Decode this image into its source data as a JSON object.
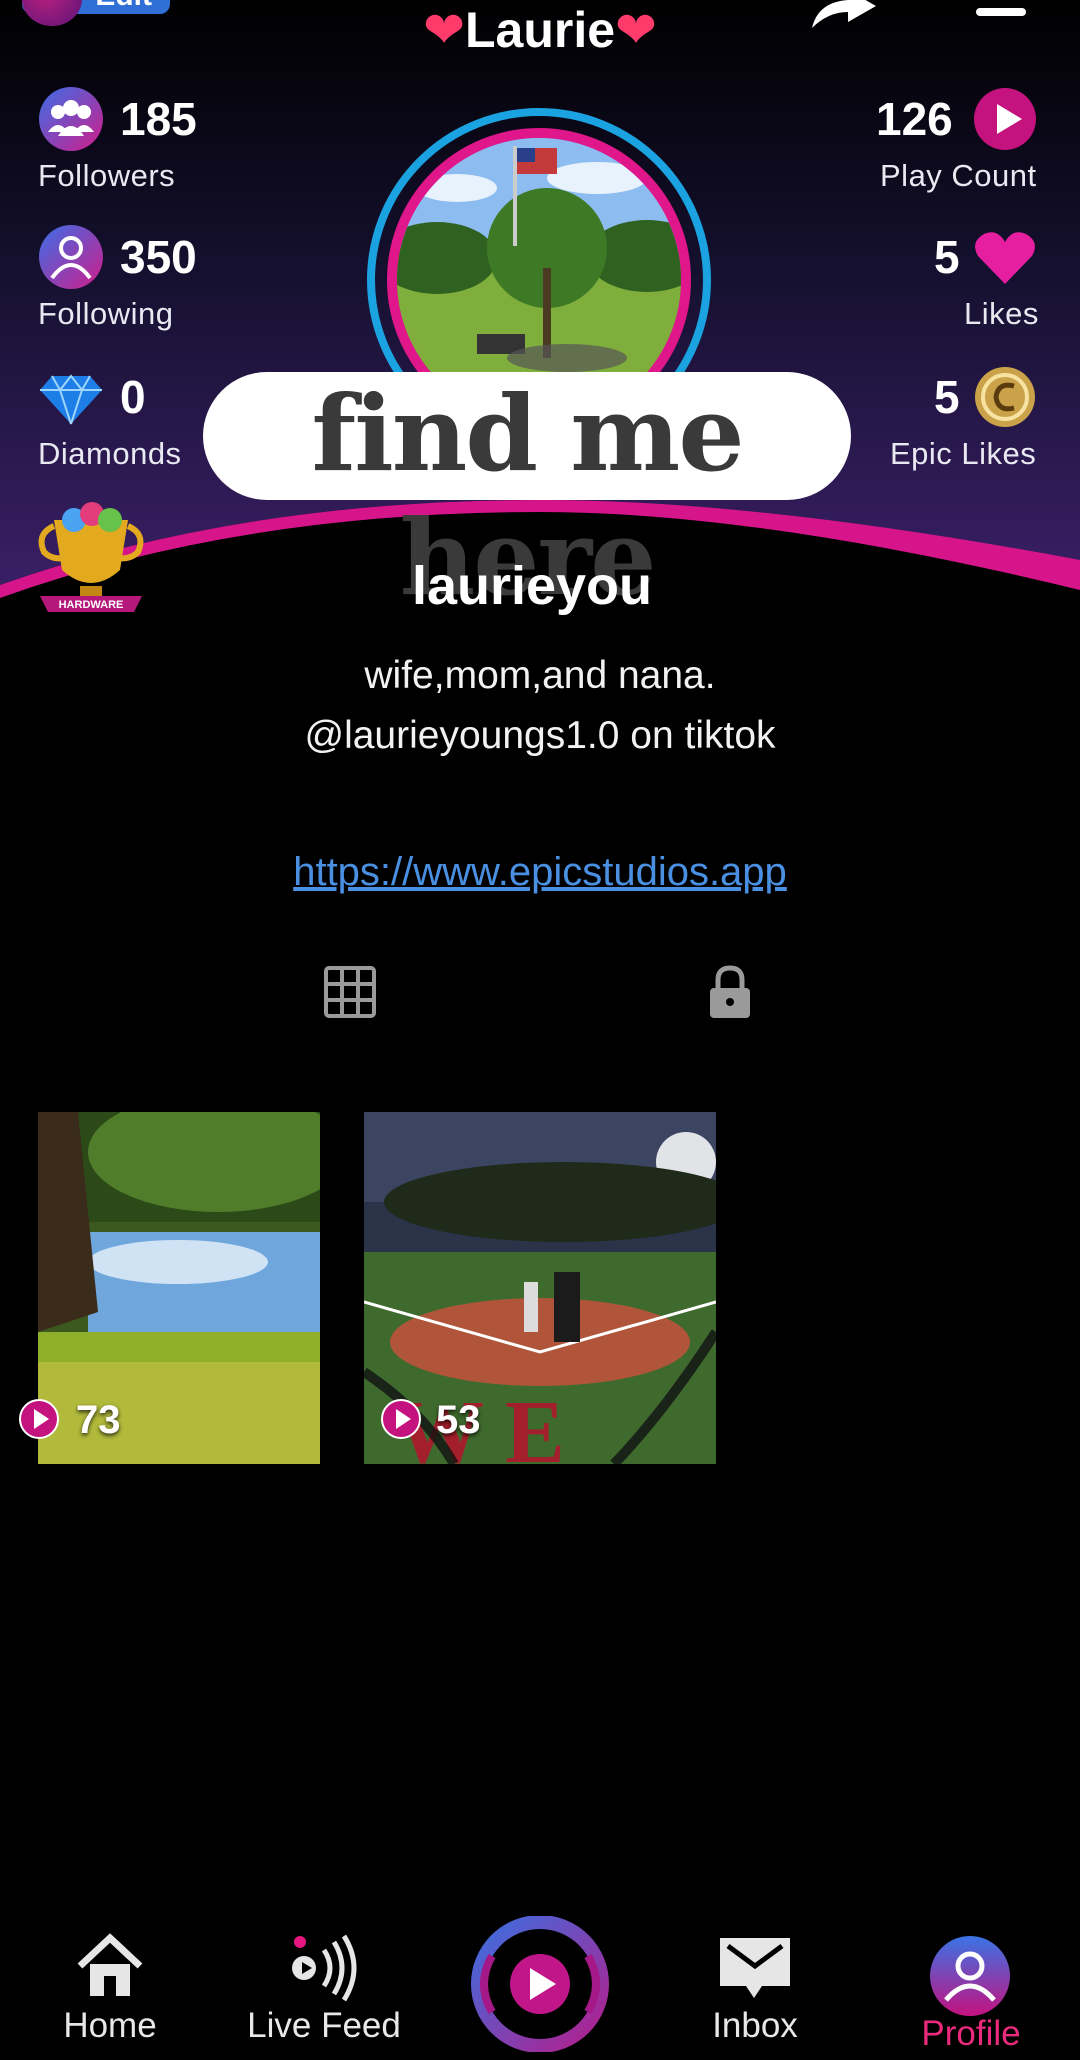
{
  "header": {
    "edit_label": "Edit",
    "title": "Laurie",
    "title_emoji": "❤"
  },
  "stats": {
    "followers": {
      "count": "185",
      "label": "Followers"
    },
    "following": {
      "count": "350",
      "label": "Following"
    },
    "diamonds": {
      "count": "0",
      "label": "Diamonds"
    },
    "play_count": {
      "count": "126",
      "label": "Play Count"
    },
    "likes": {
      "count": "5",
      "label": "Likes"
    },
    "epic_likes": {
      "count": "5",
      "label": "Epic Likes"
    }
  },
  "sticker_text": "find me here",
  "badge": {
    "text": "HARDWARE"
  },
  "profile": {
    "username": "laurieyou",
    "bio_line1": "wife,mom,and nana.",
    "bio_line2": "@laurieyoungs1.0  on tiktok",
    "link": "https://www.epicstudios.app"
  },
  "tabs": {
    "grid_icon": "grid-icon",
    "private_icon": "lock-icon"
  },
  "videos": [
    {
      "views": "73"
    },
    {
      "views": "53"
    }
  ],
  "nav": {
    "home": "Home",
    "live_feed": "Live Feed",
    "inbox": "Inbox",
    "profile": "Profile",
    "active": "Profile"
  },
  "colors": {
    "accent_pink": "#e0168b",
    "ring_blue": "#1aa3e0",
    "link_blue": "#4a90e2",
    "active_nav": "#ea2b7d"
  }
}
